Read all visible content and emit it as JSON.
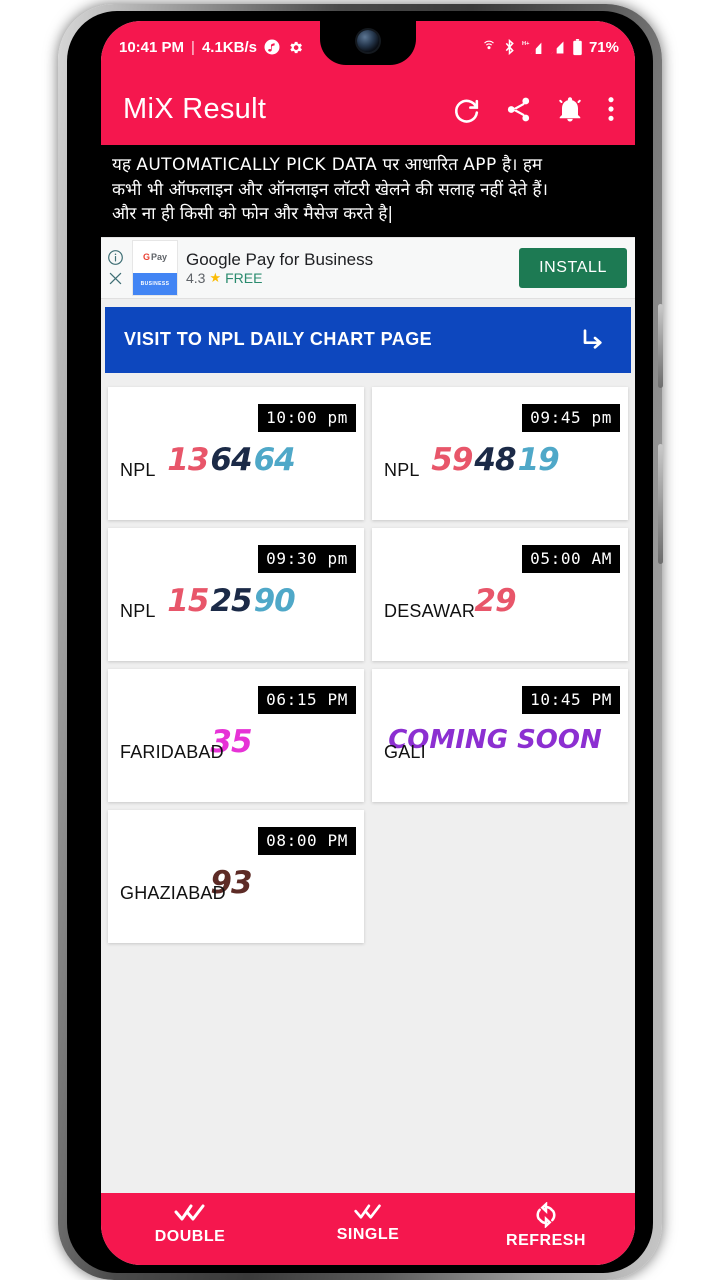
{
  "statusbar": {
    "time": "10:41 PM",
    "separator": "|",
    "net_speed": "4.1KB/s",
    "icons_left": [
      "music-icon",
      "gear-icon"
    ],
    "icons_right": [
      "hotspot-icon",
      "bluetooth-icon",
      "hplus-signal-icon",
      "signal-icon",
      "battery-icon"
    ],
    "battery_percent": "71%"
  },
  "appbar": {
    "title": "MiX Result",
    "actions": [
      "refresh-icon",
      "share-icon",
      "notification-bell-icon",
      "overflow-menu-icon"
    ],
    "bg_color": "#f5174e"
  },
  "notice": {
    "line1_pre": "यह ",
    "line1_en": "AUTOMATICALLY PICK DATA",
    "line1_post": " पर आधारित ",
    "line1_en2": "APP",
    "line1_end": " है। हम",
    "line2": "कभी भी ऑफलाइन और ऑनलाइन लॉटरी खेलने की सलाह नहीं देते हैं।",
    "line3": "और ना ही किसी को फोन और मैसेज करते है|"
  },
  "ad": {
    "icon_label_top": "Pay",
    "icon_g": "G",
    "icon_label_bottom": "BUSINESS",
    "title": "Google Pay for Business",
    "rating": "4.3",
    "price": "FREE",
    "install_label": "INSTALL",
    "info_icon": "info-icon",
    "close_icon": "close-icon",
    "install_color": "#1d7a53"
  },
  "banner": {
    "label": "VISIT TO NPL DAILY CHART PAGE",
    "arrow_icon": "subdirectory-arrow-right-icon",
    "bg_color": "#0d47be"
  },
  "colors": {
    "red": "#e8566a",
    "navy": "#1b2a47",
    "lightblue": "#4fa8c8",
    "magenta": "#e633d6",
    "purple": "#8c2fd1",
    "brown": "#5d2b26"
  },
  "results": [
    {
      "time": "10:00 pm",
      "label": "NPL",
      "numbers": [
        {
          "v": "13",
          "c": "#e8566a"
        },
        {
          "v": "64",
          "c": "#1b2a47"
        },
        {
          "v": "64",
          "c": "#4fa8c8"
        }
      ]
    },
    {
      "time": "09:45 pm",
      "label": "NPL",
      "numbers": [
        {
          "v": "59",
          "c": "#e8566a"
        },
        {
          "v": "48",
          "c": "#1b2a47"
        },
        {
          "v": "19",
          "c": "#4fa8c8"
        }
      ]
    },
    {
      "time": "09:30 pm",
      "label": "NPL",
      "numbers": [
        {
          "v": "15",
          "c": "#e8566a"
        },
        {
          "v": "25",
          "c": "#1b2a47"
        },
        {
          "v": "90",
          "c": "#4fa8c8"
        }
      ]
    },
    {
      "time": "05:00 AM",
      "label": "DESAWAR",
      "numbers": [
        {
          "v": "29",
          "c": "#e8566a"
        }
      ]
    },
    {
      "time": "06:15 PM",
      "label": "FARIDABAD",
      "numbers": [
        {
          "v": "35",
          "c": "#e633d6"
        }
      ]
    },
    {
      "time": "10:45 PM",
      "label": "GALI",
      "numbers": [
        {
          "v": "COMING SOON",
          "c": "#8c2fd1"
        }
      ],
      "soon": true
    },
    {
      "time": "08:00 PM",
      "label": "GHAZIABAD",
      "numbers": [
        {
          "v": "93",
          "c": "#5d2b26"
        }
      ]
    }
  ],
  "bottomnav": {
    "items": [
      {
        "label": "DOUBLE",
        "icon": "double-check-icon"
      },
      {
        "label": "SINGLE",
        "icon": "double-check-small-icon"
      },
      {
        "label": "REFRESH",
        "icon": "sync-refresh-icon"
      }
    ],
    "bg_color": "#f5174e"
  }
}
